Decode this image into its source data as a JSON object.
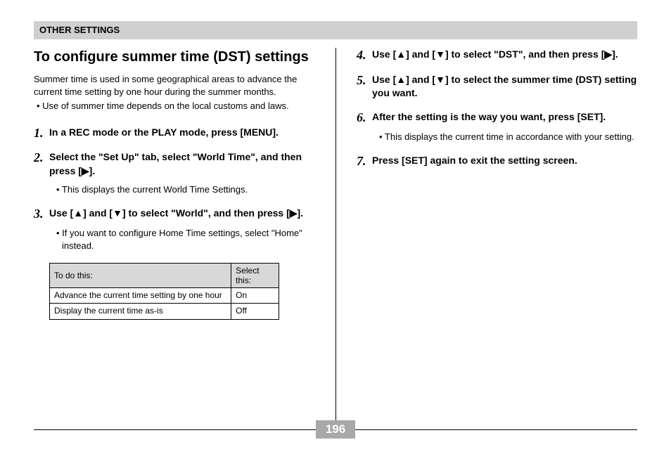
{
  "header": {
    "title": "OTHER SETTINGS"
  },
  "left": {
    "section_title": "To configure summer time (DST) settings",
    "intro": "Summer time is used in some geographical areas to advance the current time setting by one hour during the summer months.",
    "intro_bullet": "• Use of summer time depends on the local customs and laws.",
    "steps": {
      "s1": {
        "num": "1.",
        "text": "In a REC mode or the PLAY mode, press [MENU]."
      },
      "s2": {
        "num": "2.",
        "text": "Select the \"Set Up\" tab, select \"World Time\", and then press [▶].",
        "sub": "•  This displays the current World Time Settings."
      },
      "s3": {
        "num": "3.",
        "text": "Use [▲] and [▼] to select \"World\", and then press [▶].",
        "sub": "•  If you want to configure Home Time settings, select \"Home\" instead."
      }
    },
    "table": {
      "head_todo": "To do this:",
      "head_select": "Select this:",
      "rows": [
        {
          "todo": "Advance the current time setting by one hour",
          "select": "On"
        },
        {
          "todo": "Display the current time as-is",
          "select": "Off"
        }
      ]
    }
  },
  "right": {
    "steps": {
      "s4": {
        "num": "4.",
        "text": "Use [▲] and [▼] to select \"DST\", and then press [▶]."
      },
      "s5": {
        "num": "5.",
        "text": "Use [▲] and [▼] to select the summer time (DST) setting you want."
      },
      "s6": {
        "num": "6.",
        "text": "After the setting is the way you want, press [SET].",
        "sub": "•  This displays the current time in accordance with your setting."
      },
      "s7": {
        "num": "7.",
        "text": "Press [SET] again to exit the setting screen."
      }
    }
  },
  "footer": {
    "page": "196"
  }
}
